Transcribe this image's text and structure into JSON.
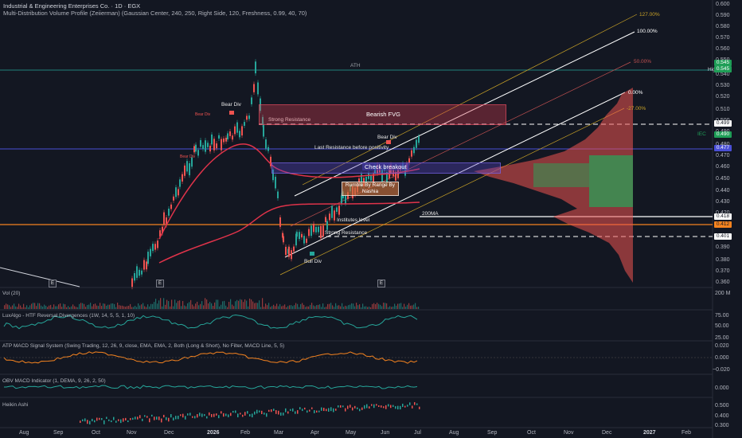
{
  "header": {
    "title": "Industrial & Engineering Enterprises Co. · 1D · EGX",
    "indicator": "Multi-Distribution Volume Profile (Zeiierman) (Gaussian Center, 240, 250, Right Side, 120, Freshness, 0.99, 40, 70)"
  },
  "price_axis": {
    "ticks": [
      "0.600",
      "0.590",
      "0.580",
      "0.570",
      "0.560",
      "0.550",
      "0.540",
      "0.530",
      "0.520",
      "0.510",
      "0.500",
      "0.490",
      "0.480",
      "0.470",
      "0.460",
      "0.450",
      "0.440",
      "0.430",
      "0.420",
      "0.410",
      "0.400",
      "0.390",
      "0.380",
      "0.370",
      "0.360"
    ],
    "badges": [
      {
        "text": "0.545",
        "bg": "#1f9e57",
        "fg": "#ffffff"
      },
      {
        "text": "0.545",
        "bg": "#1f9e57",
        "fg": "#ffffff"
      },
      {
        "text": "0.499",
        "bg": "#ffffff",
        "fg": "#131722"
      },
      {
        "text": "0.490",
        "bg": "#1f9e57",
        "fg": "#ffffff"
      },
      {
        "text": "0.477",
        "bg": "#4a4fd6",
        "fg": "#ffffff"
      },
      {
        "text": "0.418",
        "bg": "#ffffff",
        "fg": "#131722"
      },
      {
        "text": "0.412",
        "bg": "#f5831f",
        "fg": "#131722"
      },
      {
        "text": "0.401",
        "bg": "#ffffff",
        "fg": "#131722"
      }
    ],
    "high_label": "High",
    "ticker_label": "IEC"
  },
  "annotations": {
    "ath": "ATH",
    "bear_div_1": "Bear Div",
    "bear_div_small_1": "Bear Div",
    "bear_div_small_2": "Bear Div",
    "bear_div_2": "Bear Div",
    "bull_div": "Bull Div",
    "strong_resistance_1": "Strong Resistance",
    "bearish_fvg": "Bearish FVG",
    "last_resistance": "Last Resistance before positivity",
    "check_breakout": "Check breakout",
    "rumble": "Rumble By Range By Nashia",
    "institutes": "Institutes level",
    "strong_resistance_2": "Strong Resistance",
    "ma200": "200MA",
    "fib_127": "127.00%",
    "fib_100": "100.00%",
    "fib_50": "50.00%",
    "fib_0": "0.00%",
    "fib_neg27": "-27.00%"
  },
  "panels": {
    "vol": {
      "label": "Vol (20)",
      "ticks": [
        "200 M"
      ]
    },
    "luxalgo": {
      "label": "LuxAlgo - HTF Reversal Divergences (1W, 14, 5, 5, 1, 10)",
      "ticks": [
        "75.00",
        "50.00",
        "25.00"
      ]
    },
    "atp": {
      "label": "ATP MACD Signal System (Swing Trading, 12, 26, 9, close, EMA, EMA, 2, Both (Long & Short), No Filter, MACD Line, 5, 5)",
      "ticks": [
        "0.020",
        "0.000",
        "−0.020"
      ]
    },
    "obv": {
      "label": "OBV MACD Indicator (1, DEMA, 9, 26, 2, 50)",
      "ticks": [
        "0.000"
      ]
    },
    "heikin": {
      "label": "Heikin Ashi",
      "ticks": [
        "0.500",
        "0.400",
        "0.300"
      ]
    }
  },
  "time_axis": [
    "Aug",
    "Sep",
    "Oct",
    "Nov",
    "Dec",
    "2026",
    "Feb",
    "Mar",
    "Apr",
    "May",
    "Jun",
    "Jul",
    "Aug",
    "Sep",
    "Oct",
    "Nov",
    "Dec",
    "2027",
    "Feb"
  ],
  "event_markers": [
    "E",
    "E",
    "E"
  ],
  "colors": {
    "bg": "#131722",
    "up": "#26a69a",
    "down": "#ef5350",
    "accent_blue": "#4a4fd6",
    "orange": "#f5831f",
    "ma": "#e0334a"
  }
}
